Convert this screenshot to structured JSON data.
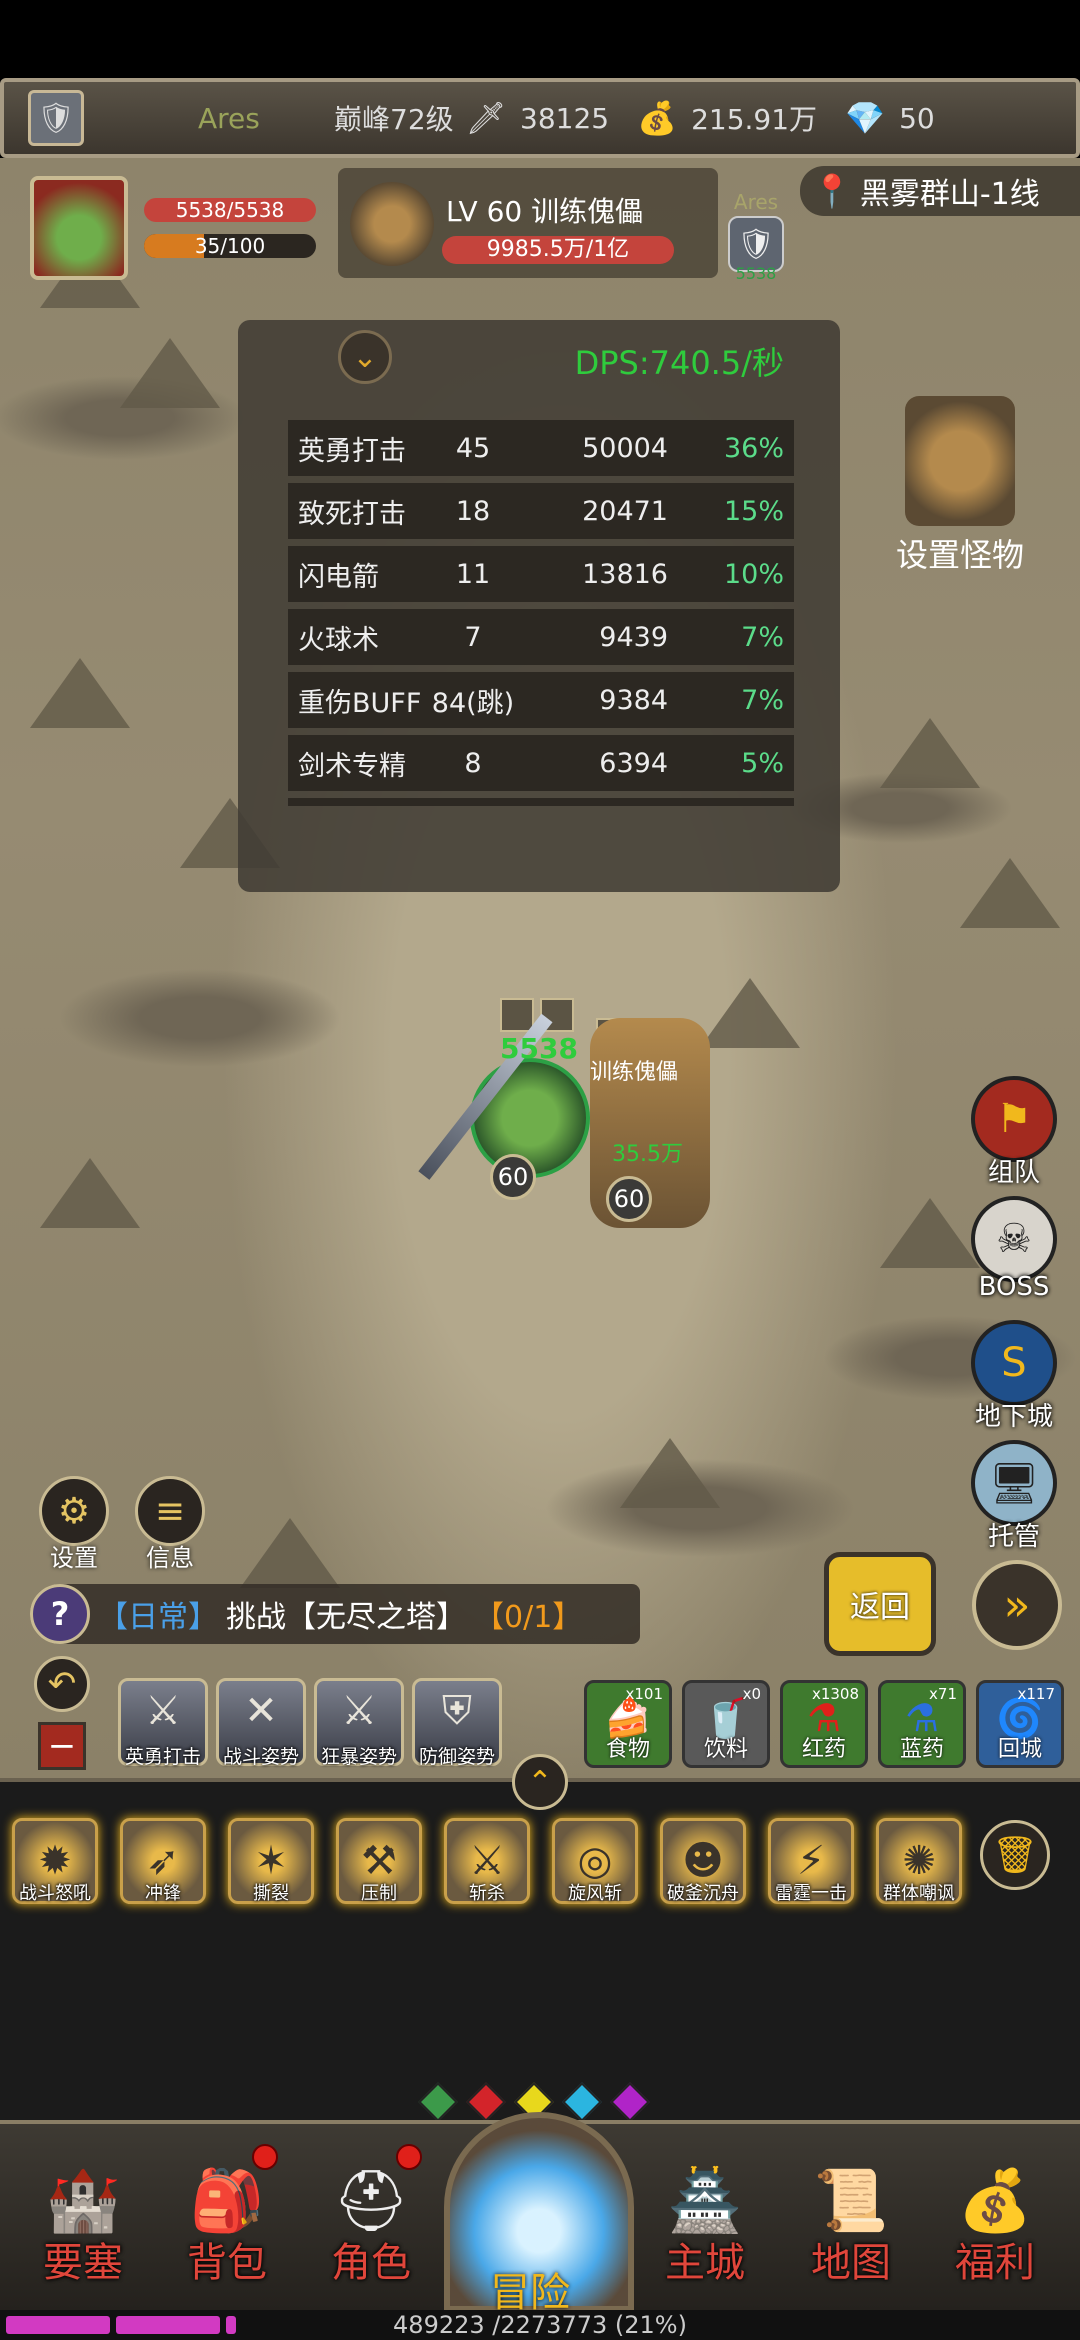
{
  "top_bar": {
    "player_name": "Ares",
    "rank": "巅峰72级",
    "sword_power": "38125",
    "gold": "215.91万",
    "diamonds": "50"
  },
  "player": {
    "hp": "5538/5538",
    "mp": "35/100",
    "mp_fraction": 0.35
  },
  "enemy": {
    "name": "LV 60 训练傀儡",
    "hp": "9985.5万/1亿"
  },
  "ares_badge": {
    "name": "Ares",
    "sub": "5538"
  },
  "location": "黑雾群山-1线",
  "dps": {
    "label": "DPS:740.5/秒",
    "rows": [
      {
        "skill": "英勇打击",
        "count": "45",
        "damage": "50004",
        "percent": "36%"
      },
      {
        "skill": "致死打击",
        "count": "18",
        "damage": "20471",
        "percent": "15%"
      },
      {
        "skill": "闪电箭",
        "count": "11",
        "damage": "13816",
        "percent": "10%"
      },
      {
        "skill": "火球术",
        "count": "7",
        "damage": "9439",
        "percent": "7%"
      },
      {
        "skill": "重伤BUFF",
        "count": "84(跳)",
        "damage": "9384",
        "percent": "7%"
      },
      {
        "skill": "剑术专精",
        "count": "8",
        "damage": "6394",
        "percent": "5%"
      }
    ]
  },
  "set_monster_label": "设置怪物",
  "battle": {
    "hero_hp": "5538",
    "hero_level": "60",
    "enemy_level": "60",
    "enemy_name": "训练傀儡",
    "damage_float": "35.5万"
  },
  "side_buttons": {
    "team": "组队",
    "boss": "BOSS",
    "dungeon": "地下城",
    "auto": "托管"
  },
  "left_buttons": {
    "settings": "设置",
    "info": "信息"
  },
  "quest": {
    "icon": "?",
    "tag": "【日常】",
    "text": "挑战【无尽之塔】",
    "progress": "【0/1】"
  },
  "back_button": "返回",
  "stances": [
    "英勇打击",
    "战斗姿势",
    "狂暴姿势",
    "防御姿势"
  ],
  "items": [
    {
      "count": "x101",
      "label": "食物"
    },
    {
      "count": "x0",
      "label": "饮料"
    },
    {
      "count": "x1308",
      "label": "红药"
    },
    {
      "count": "x71",
      "label": "蓝药"
    },
    {
      "count": "x117",
      "label": "回城"
    }
  ],
  "skills": [
    "战斗怒吼",
    "冲锋",
    "撕裂",
    "压制",
    "斩杀",
    "旋风斩",
    "破釜沉舟",
    "雷霆一击",
    "群体嘲讽"
  ],
  "nav": [
    "要塞",
    "背包",
    "角色",
    "冒险",
    "主城",
    "地图",
    "福利"
  ],
  "exp_text": "489223 /2273773 (21%)",
  "exp_fraction": 0.21,
  "colors": {
    "dps_green": "#2fcc3d",
    "percent_green": "#5bdc8a",
    "nav_red": "#e0463b",
    "gold": "#f1b81c"
  }
}
